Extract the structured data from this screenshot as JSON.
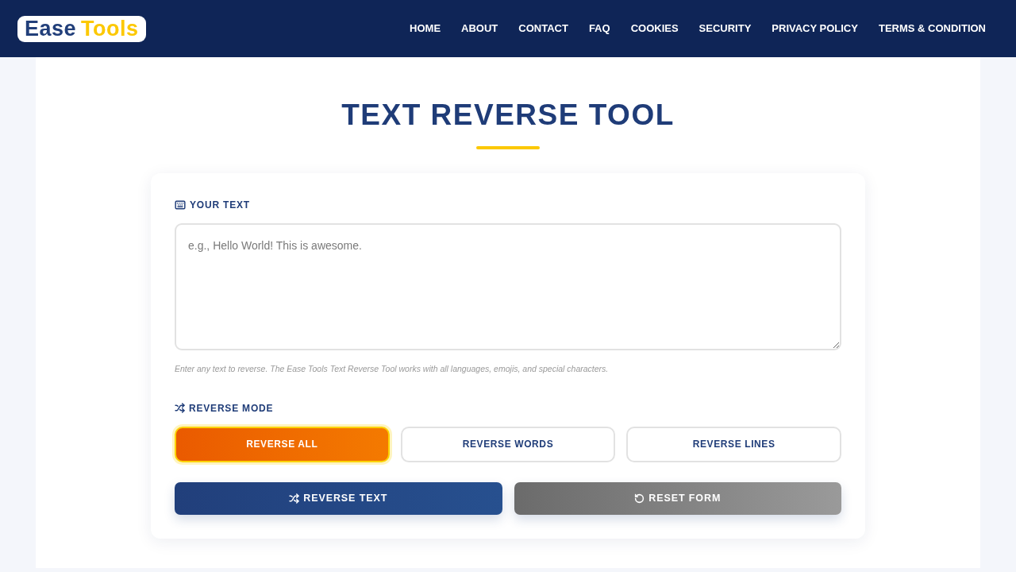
{
  "header": {
    "logo": {
      "first_word": "Ease",
      "second_word": "Tools"
    },
    "nav": [
      "HOME",
      "ABOUT",
      "CONTACT",
      "FAQ",
      "COOKIES",
      "SECURITY",
      "PRIVACY POLICY",
      "TERMS & CONDITION"
    ]
  },
  "page": {
    "title": "TEXT REVERSE TOOL"
  },
  "form": {
    "text_label": "YOUR TEXT",
    "text_field": {
      "placeholder": "e.g., Hello World! This is awesome."
    },
    "hint": "Enter any text to reverse. The Ease Tools Text Reverse Tool works with all languages, emojis, and special characters.",
    "mode_label": "REVERSE MODE",
    "modes": [
      {
        "label": "REVERSE ALL",
        "selected": true
      },
      {
        "label": "REVERSE WORDS",
        "selected": false
      },
      {
        "label": "REVERSE LINES",
        "selected": false
      }
    ],
    "actions": [
      {
        "kind": "submit",
        "label": "REVERSE TEXT"
      },
      {
        "kind": "reset",
        "label": "RESET FORM"
      }
    ]
  }
}
